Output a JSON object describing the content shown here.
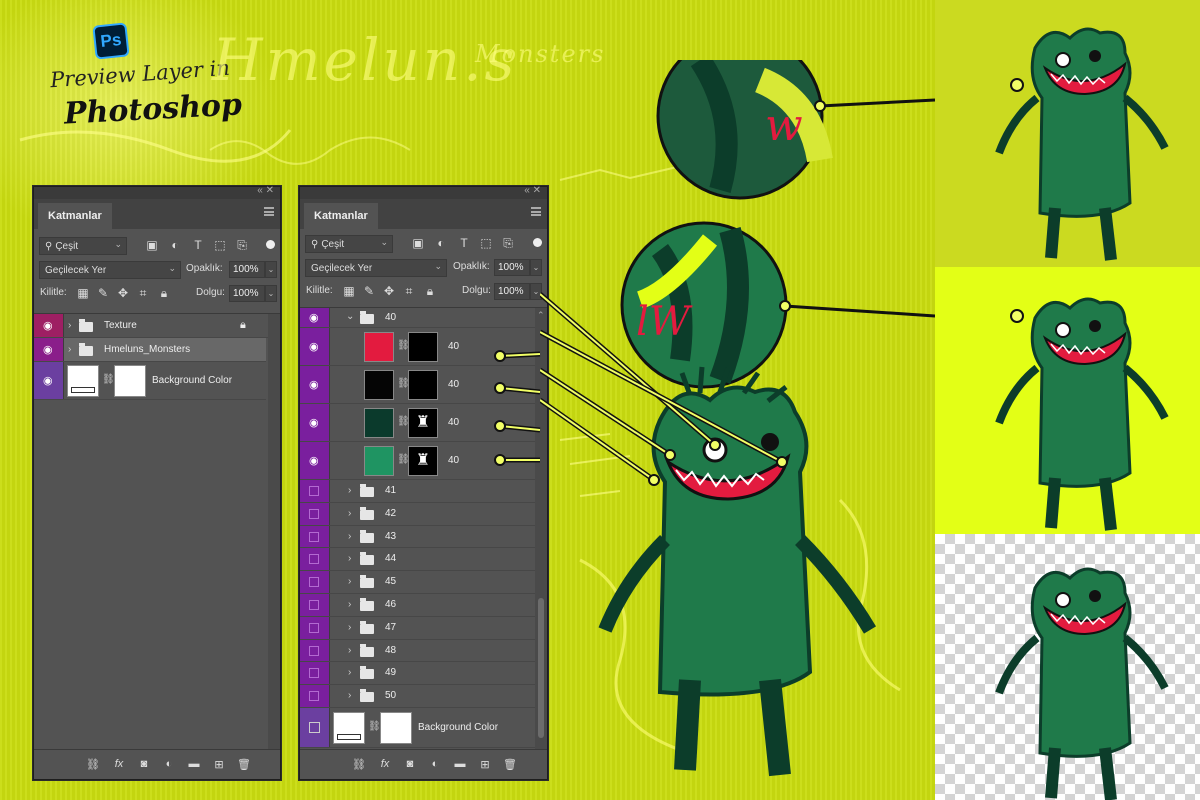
{
  "brand": {
    "badge": "Ps",
    "preview_line1": "Preview Layer in",
    "preview_line2": "Photoshop",
    "title": "Hmelun.s",
    "subtitle": "Monsters"
  },
  "panel_left": {
    "tab": "Katmanlar",
    "filter_kind": "Çeşit",
    "blend_mode": "Geçilecek Yer",
    "opacity_label": "Opaklık:",
    "opacity_value": "100%",
    "lock_label": "Kilitle:",
    "fill_label": "Dolgu:",
    "fill_value": "100%",
    "layers": [
      {
        "name": "Texture",
        "eye_color": "#9e1f63",
        "locked": true
      },
      {
        "name": "Hmeluns_Monsters",
        "eye_color": "#8a1e8a",
        "selected": true
      },
      {
        "name": "Background Color",
        "eye_color": "#6b3fa0"
      }
    ]
  },
  "panel_right": {
    "tab": "Katmanlar",
    "filter_kind": "Çeşit",
    "blend_mode": "Geçilecek Yer",
    "opacity_label": "Opaklık:",
    "opacity_value": "100%",
    "lock_label": "Kilitle:",
    "fill_label": "Dolgu:",
    "fill_value": "100%",
    "open_group": "40",
    "sublayers": [
      {
        "name": "40",
        "swatch": "#e31b3f"
      },
      {
        "name": "40",
        "swatch": "#050505"
      },
      {
        "name": "40",
        "swatch": "#0b3a2c"
      },
      {
        "name": "40",
        "swatch": "#1f9462"
      }
    ],
    "groups": [
      "41",
      "42",
      "43",
      "44",
      "45",
      "46",
      "47",
      "48",
      "49",
      "50"
    ],
    "background_layer": "Background Color",
    "eye_color": "#7a1f9e",
    "bg_eye_color": "#6b3fa0"
  },
  "colors": {
    "lime_bg": "#c9dc10",
    "preview_yellow": "#e3ff16",
    "monster_green": "#1f7a4a",
    "monster_dark": "#0c3d2a",
    "mouth_red": "#e31b3f",
    "panel_gray": "#535353"
  },
  "icons": {
    "visibility": "eye-icon",
    "folder": "folder-icon",
    "lock": "lock-icon",
    "link": "link-icon"
  }
}
